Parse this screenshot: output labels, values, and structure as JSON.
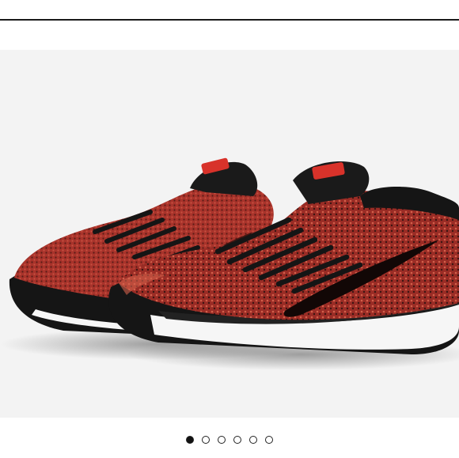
{
  "listing": {
    "photo_count": 6,
    "active_photo_index": 0,
    "product_image": "red-black-knit-running-sneakers-photo"
  },
  "colors": {
    "knit_red": "#a8332b",
    "knit_dark": "#3a1512",
    "sole_black": "#151515",
    "midsole_white": "#f6f6f6",
    "background": "#f3f3f3"
  },
  "carousel": {
    "dots": [
      {
        "state": "active"
      },
      {
        "state": "inactive"
      },
      {
        "state": "inactive"
      },
      {
        "state": "inactive"
      },
      {
        "state": "inactive"
      },
      {
        "state": "inactive"
      }
    ]
  }
}
